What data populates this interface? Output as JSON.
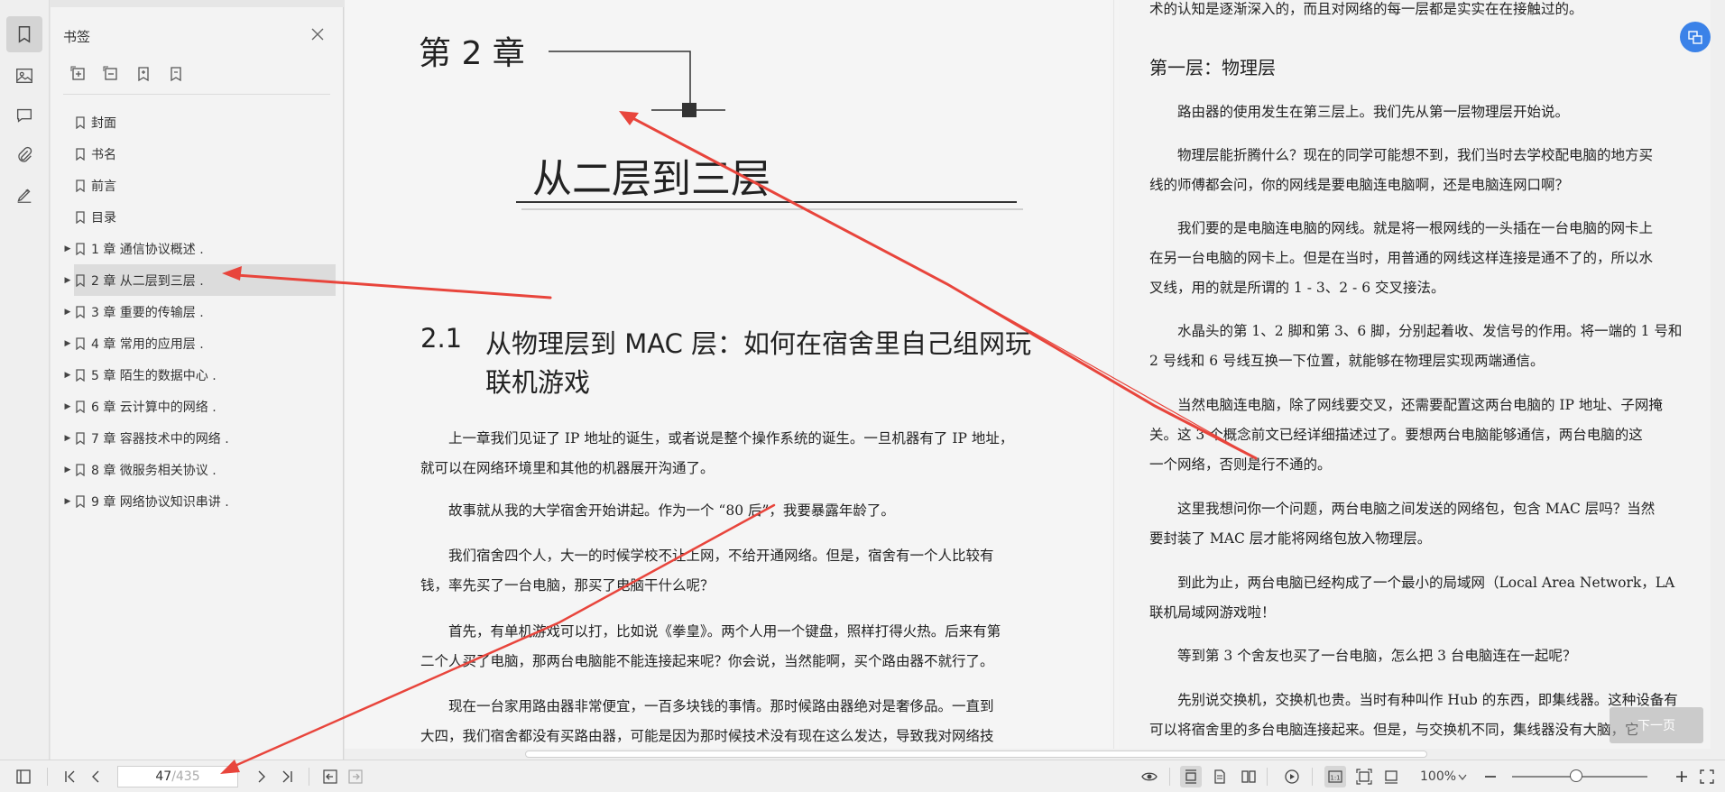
{
  "sidebar": {
    "title": "书签",
    "items": [
      {
        "label": "封面",
        "expandable": false
      },
      {
        "label": "书名",
        "expandable": false
      },
      {
        "label": "前言",
        "expandable": false
      },
      {
        "label": "目录",
        "expandable": false
      },
      {
        "label": "1 章 通信协议概述 .",
        "expandable": true
      },
      {
        "label": "2 章 从二层到三层 .",
        "expandable": true,
        "selected": true
      },
      {
        "label": "3 章 重要的传输层 .",
        "expandable": true
      },
      {
        "label": "4 章 常用的应用层 .",
        "expandable": true
      },
      {
        "label": "5 章 陌生的数据中心 .",
        "expandable": true
      },
      {
        "label": "6 章 云计算中的网络 .",
        "expandable": true
      },
      {
        "label": "7 章 容器技术中的网络 .",
        "expandable": true
      },
      {
        "label": "8 章 微服务相关协议 .",
        "expandable": true
      },
      {
        "label": "9 章 网络协议知识串讲 .",
        "expandable": true
      }
    ]
  },
  "page_left": {
    "chapter_no": "第 2 章",
    "chapter_title": "从二层到三层",
    "section_num": "2.1",
    "section_title_1": "从物理层到 MAC 层：如何在宿舍里自己组网玩",
    "section_title_2": "联机游戏",
    "paragraphs": [
      "　　上一章我们见证了 IP 地址的诞生，或者说是整个操作系统的诞生。一旦机器有了 IP 地址，",
      "就可以在网络环境里和其他的机器展开沟通了。",
      "　　故事就从我的大学宿舍开始讲起。作为一个 “80 后”，我要暴露年龄了。",
      "　　我们宿舍四个人，大一的时候学校不让上网，不给开通网络。但是，宿舍有一个人比较有",
      "钱，率先买了一台电脑，那买了电脑干什么呢？",
      "　　首先，有单机游戏可以打，比如说《拳皇》。两个人用一个键盘，照样打得火热。后来有第",
      "二个人买了电脑，那两台电脑能不能连接起来呢？你会说，当然能啊，买个路由器不就行了。",
      "　　现在一台家用路由器非常便宜，一百多块钱的事情。那时候路由器绝对是奢侈品。一直到",
      "大四，我们宿舍都没有买路由器，可能是因为那时候技术没有现在这么发达，导致我对网络技"
    ]
  },
  "page_right": {
    "top_line": "术的认知是逐渐深入的，而且对网络的每一层都是实实在在接触过的。",
    "heading": "第一层：物理层",
    "paragraphs": [
      "　　路由器的使用发生在第三层上。我们先从第一层物理层开始说。",
      "　　物理层能折腾什么？现在的同学可能想不到，我们当时去学校配电脑的地方买",
      "线的师傅都会问，你的网线是要电脑连电脑啊，还是电脑连网口啊？",
      "　　我们要的是电脑连电脑的网线。就是将一根网线的一头插在一台电脑的网卡上",
      "在另一台电脑的网卡上。但是在当时，用普通的网线这样连接是通不了的，所以水",
      "叉线，用的就是所谓的 1 - 3、2 - 6 交叉接法。",
      "　　水晶头的第 1、2 脚和第 3、6 脚，分别起着收、发信号的作用。将一端的 1 号和",
      "2 号线和 6 号线互换一下位置，就能够在物理层实现两端通信。",
      "　　当然电脑连电脑，除了网线要交叉，还需要配置这两台电脑的 IP 地址、子网掩",
      "关。这 3 个概念前文已经详细描述过了。要想两台电脑能够通信，两台电脑的这",
      "一个网络，否则是行不通的。",
      "　　这里我想问你一个问题，两台电脑之间发送的网络包，包含 MAC 层吗？当然",
      "要封装了 MAC 层才能将网络包放入物理层。",
      "　　到此为止，两台电脑已经构成了一个最小的局域网（Local Area Network，LA",
      "联机局域网游戏啦！",
      "　　等到第 3 个舍友也买了一台电脑，怎么把 3 台电脑连在一起呢？",
      "　　先别说交换机，交换机也贵。当时有种叫作 Hub 的东西，即集线器。这种设备有",
      "可以将宿舍里的多台电脑连接起来。但是，与交换机不同，集线器没有大脑，它"
    ]
  },
  "overlay": {
    "next_page_label": "下一页"
  },
  "toolbar": {
    "current_page": "47",
    "total_pages": "/435",
    "zoom": "100%",
    "zoom_fraction": 0.47
  },
  "colors": {
    "annotation_red": "#e8453c",
    "fab_blue": "#3b82e8"
  }
}
